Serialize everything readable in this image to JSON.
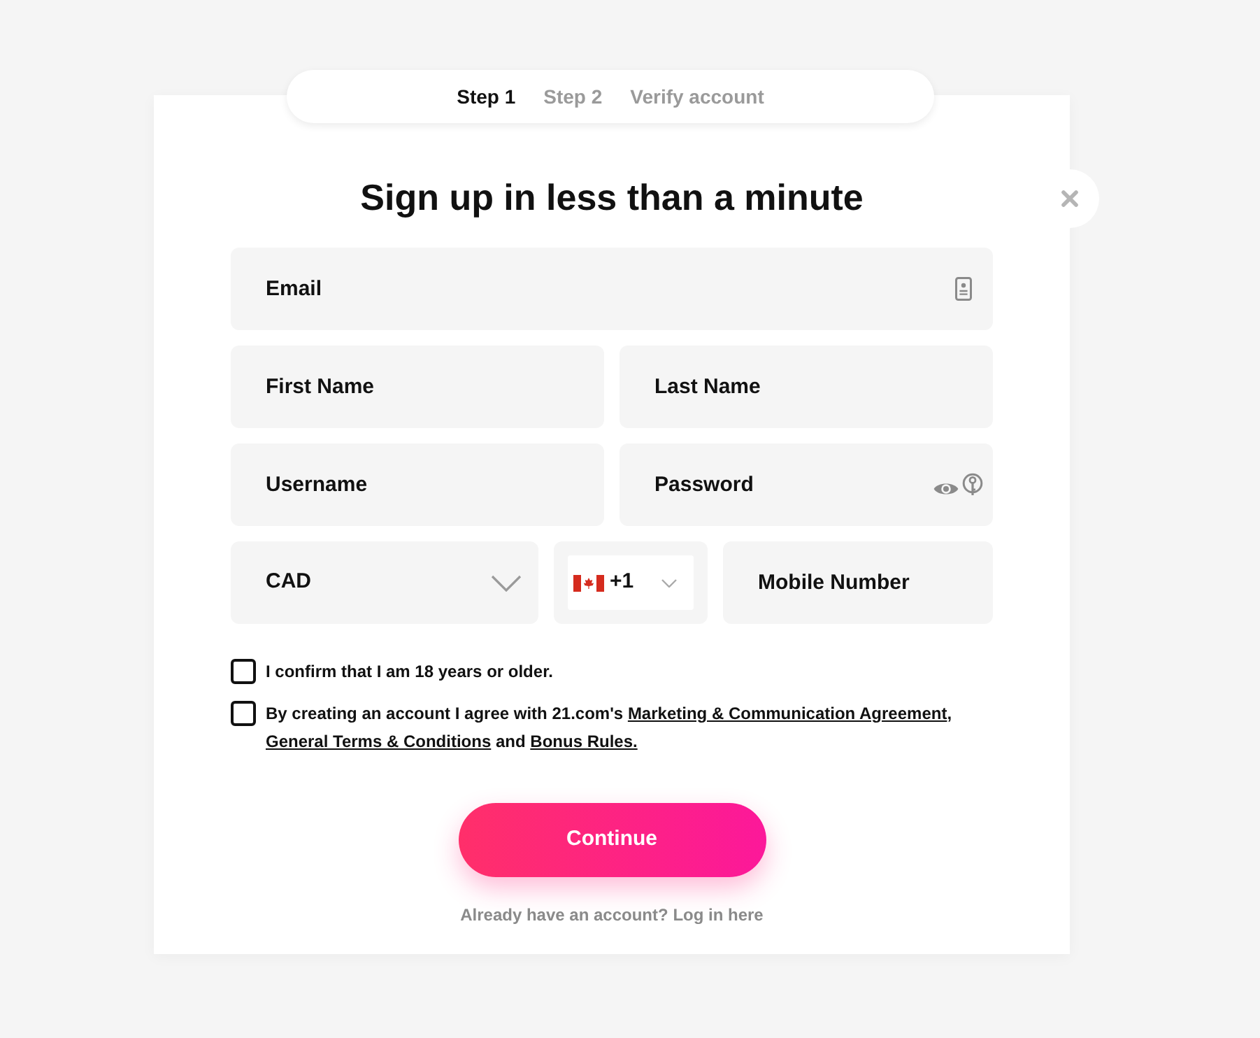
{
  "steps": [
    {
      "label": "Step 1",
      "selected": true
    },
    {
      "label": "Step 2",
      "selected": false
    },
    {
      "label": "Verify account",
      "selected": false
    }
  ],
  "title": "Sign up in less than a minute",
  "rows": [
    [
      {
        "kind": "email",
        "placeholder": "Email"
      }
    ],
    [
      {
        "kind": "text",
        "placeholder": "First Name"
      },
      {
        "kind": "text",
        "placeholder": "Last Name"
      }
    ],
    [
      {
        "kind": "text",
        "placeholder": "Username"
      },
      {
        "kind": "password",
        "placeholder": "Password"
      }
    ],
    [
      {
        "kind": "select",
        "value": "CAD"
      },
      {
        "kind": "phone_code",
        "value": "+1"
      },
      {
        "kind": "tel",
        "placeholder": "Mobile Number"
      }
    ]
  ],
  "agreements": [
    {
      "checked": false,
      "parts": [
        {
          "kind": "text",
          "text": "I confirm that I am 18 years or older."
        }
      ]
    },
    {
      "checked": false,
      "parts": [
        {
          "kind": "text",
          "text": "By creating an account I agree with 21.com's "
        },
        {
          "kind": "link",
          "text": "Marketing & Communication Agreement"
        },
        {
          "kind": "text",
          "text": ", "
        },
        {
          "kind": "link",
          "text": "General Terms & Conditions"
        },
        {
          "kind": "text",
          "text": " and "
        },
        {
          "kind": "link",
          "text": "Bonus Rules."
        }
      ]
    }
  ],
  "submit": {
    "label": "Continue"
  },
  "login_prompt": {
    "text": "Already have an account?",
    "link": "Log in here"
  }
}
